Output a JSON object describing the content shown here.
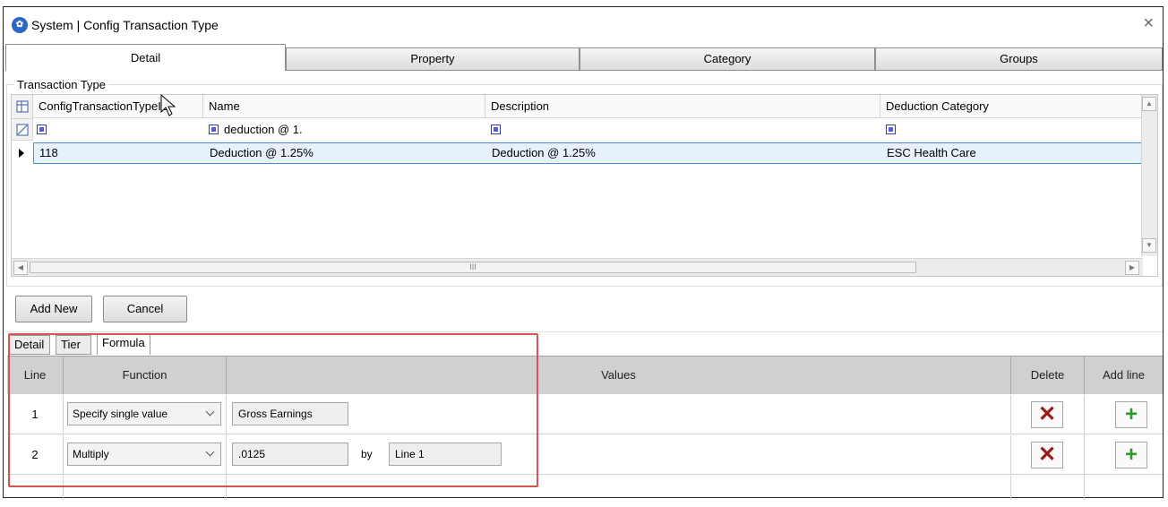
{
  "window": {
    "title": "System | Config Transaction Type",
    "close_glyph": "×"
  },
  "main_tabs": [
    {
      "label": "Detail"
    },
    {
      "label": "Property"
    },
    {
      "label": "Category"
    },
    {
      "label": "Groups"
    }
  ],
  "transaction_type": {
    "group_label": "Transaction Type",
    "columns": [
      {
        "label": "ConfigTransactionTypeID"
      },
      {
        "label": "Name"
      },
      {
        "label": "Description"
      },
      {
        "label": "Deduction Category"
      }
    ],
    "filter": {
      "name": "deduction @ 1."
    },
    "rows": [
      {
        "id": "118",
        "name": "Deduction @ 1.25%",
        "description": "Deduction @ 1.25%",
        "category": "ESC Health Care"
      }
    ],
    "hscroll_grip": "III"
  },
  "buttons": {
    "add_new": "Add New",
    "cancel": "Cancel"
  },
  "sub_tabs": [
    {
      "label": "Detail"
    },
    {
      "label": "Tier"
    },
    {
      "label": "Formula"
    }
  ],
  "formula": {
    "headers": {
      "line": "Line",
      "function": "Function",
      "values": "Values",
      "delete": "Delete",
      "add_line": "Add line"
    },
    "rows": [
      {
        "line": "1",
        "function": "Specify single value",
        "value1": "Gross Earnings"
      },
      {
        "line": "2",
        "function": "Multiply",
        "value1": ".0125",
        "by_label": "by",
        "value2": "Line 1"
      }
    ],
    "delete_glyph": "✕",
    "add_glyph": "+",
    "colors": {
      "delete": "#9a1b1b",
      "add": "#2b9a2b",
      "highlight": "#d9534f"
    }
  },
  "icons": [
    "app-logo-icon",
    "close-icon",
    "column-chooser-icon",
    "filter-clear-icon",
    "row-indicator-icon",
    "delete-icon",
    "add-icon",
    "mouse-cursor-icon"
  ]
}
